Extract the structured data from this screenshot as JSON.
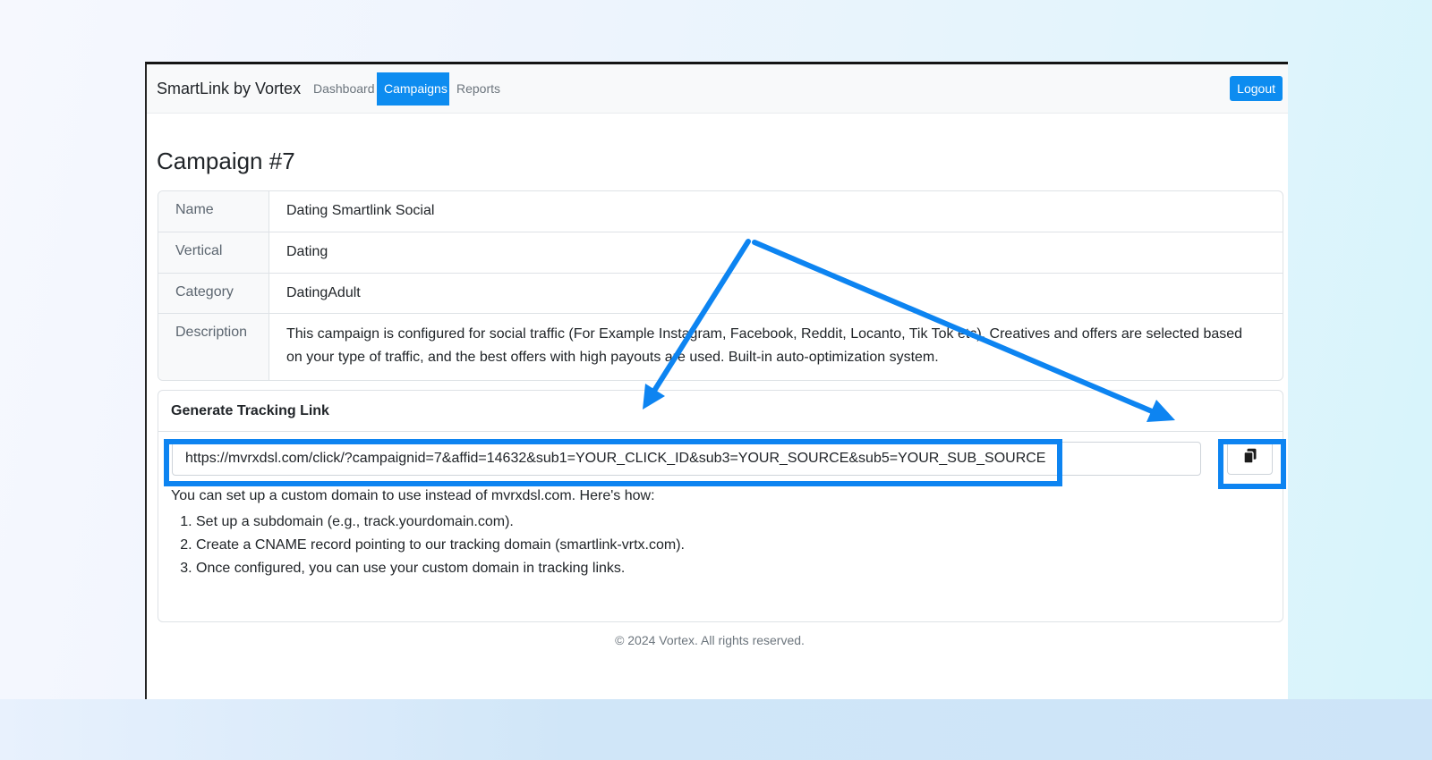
{
  "navbar": {
    "brand": "SmartLink by Vortex",
    "links": [
      "Dashboard",
      "Campaigns",
      "Reports"
    ],
    "active_link": "Campaigns",
    "logout_label": "Logout"
  },
  "page": {
    "title": "Campaign #7"
  },
  "details": [
    {
      "label": "Name",
      "value": "Dating Smartlink Social"
    },
    {
      "label": "Vertical",
      "value": "Dating"
    },
    {
      "label": "Category",
      "value": "DatingAdult"
    },
    {
      "label": "Description",
      "value": "This campaign is configured for social traffic (For Example Instagram, Facebook, Reddit, Locanto, Tik Tok etc). Creatives and offers are selected based on your type of traffic, and the best offers with high payouts are used. Built-in auto-optimization system."
    }
  ],
  "tracking": {
    "header": "Generate Tracking Link",
    "link": "https://mvrxdsl.com/click/?campaignid=7&affid=14632&sub1=YOUR_CLICK_ID&sub3=YOUR_SOURCE&sub5=YOUR_SUB_SOURCE",
    "copy_icon": "copy-icon",
    "help_intro": "You can set up a custom domain to use instead of mvrxdsl.com. Here's how:",
    "steps": [
      "Set up a subdomain (e.g., track.yourdomain.com).",
      "Create a CNAME record pointing to our tracking domain (smartlink-vrtx.com).",
      "Once configured, you can use your custom domain in tracking links."
    ]
  },
  "footer": {
    "text": "© 2024 Vortex. All rights reserved."
  },
  "colors": {
    "accent": "#0d8cf0",
    "highlight": "#0d84f1"
  }
}
